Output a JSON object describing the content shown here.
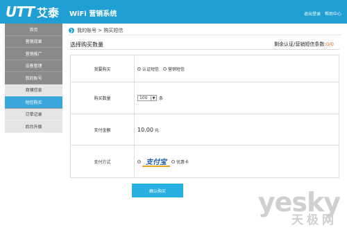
{
  "header": {
    "logo_text": "UTT",
    "logo_cn": "艾泰",
    "title": "WiFi 营销系统",
    "links": [
      "退出登录",
      "帮助中心"
    ]
  },
  "sidebar": {
    "items": [
      {
        "label": "首页"
      },
      {
        "label": "营销效果"
      },
      {
        "label": "营销推广"
      },
      {
        "label": "设备管理"
      },
      {
        "label": "我的账号"
      },
      {
        "label": "商铺信息"
      },
      {
        "label": "短信购买"
      },
      {
        "label": "订单记录"
      },
      {
        "label": "后台升级"
      }
    ]
  },
  "breadcrumb": {
    "text": "我的账号 > 购买短信"
  },
  "section": {
    "title": "选择购买数量",
    "quota_label": "剩余认证/营销短信条数:",
    "quota_value": "0/0"
  },
  "form": {
    "buy_type": {
      "label": "我要购买",
      "options": [
        "认证短信",
        "营销短信"
      ]
    },
    "quantity": {
      "label": "购买数量",
      "value": "100",
      "unit": "条"
    },
    "amount": {
      "label": "支付金额",
      "value": "10.00",
      "unit": "元"
    },
    "payment": {
      "label": "支付方式",
      "alipay": "支付宝",
      "other": "优惠卡"
    }
  },
  "confirm_label": "确认购买",
  "watermark": {
    "en": "yesky",
    "cn": "天极网"
  },
  "colors": {
    "brand": "#1f9fd3",
    "sidebar_dark": "#8a8a8a",
    "active": "#3aa7dc",
    "button": "#29b0e2"
  }
}
